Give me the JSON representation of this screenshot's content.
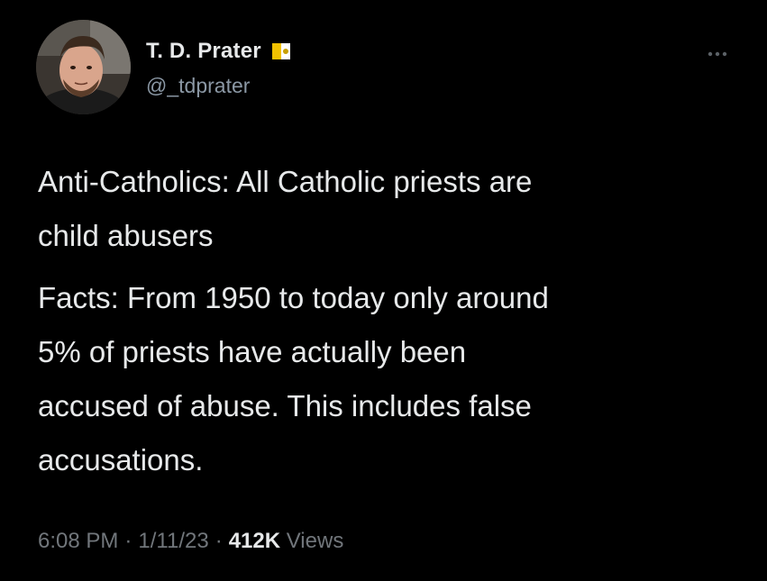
{
  "author": {
    "display_name": "T. D. Prater",
    "handle": "@_tdprater",
    "badge_icon": "papal-flag-icon"
  },
  "menu": {
    "more_icon": "more-horizontal-icon"
  },
  "tweet": {
    "lines_para1": [
      "Anti-Catholics: All Catholic priests are",
      "child abusers"
    ],
    "lines_para2": [
      "Facts: From 1950 to today only around",
      "5% of priests have actually been",
      "accused of abuse. This includes false",
      "accusations."
    ]
  },
  "meta": {
    "time": "6:08 PM",
    "separator": "·",
    "date": "1/11/23",
    "views_count": "412K",
    "views_label": "Views"
  },
  "colors": {
    "background": "#000000",
    "primary_text": "#e7e9ea",
    "secondary_text": "#71767b"
  }
}
